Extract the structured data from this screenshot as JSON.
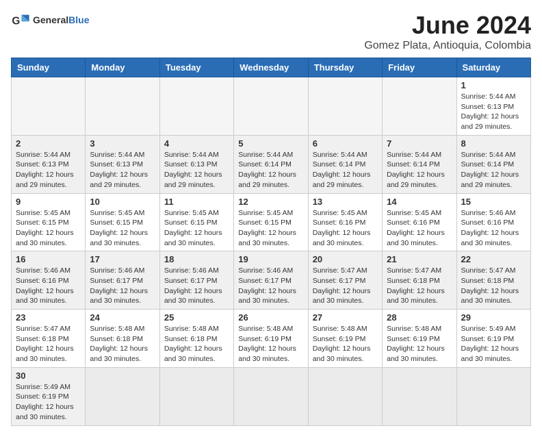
{
  "header": {
    "logo_text_regular": "General",
    "logo_text_blue": "Blue",
    "month_year": "June 2024",
    "location": "Gomez Plata, Antioquia, Colombia"
  },
  "weekdays": [
    "Sunday",
    "Monday",
    "Tuesday",
    "Wednesday",
    "Thursday",
    "Friday",
    "Saturday"
  ],
  "weeks": [
    [
      {
        "day": "",
        "info": ""
      },
      {
        "day": "",
        "info": ""
      },
      {
        "day": "",
        "info": ""
      },
      {
        "day": "",
        "info": ""
      },
      {
        "day": "",
        "info": ""
      },
      {
        "day": "",
        "info": ""
      },
      {
        "day": "1",
        "info": "Sunrise: 5:44 AM\nSunset: 6:13 PM\nDaylight: 12 hours and 29 minutes."
      }
    ],
    [
      {
        "day": "2",
        "info": "Sunrise: 5:44 AM\nSunset: 6:13 PM\nDaylight: 12 hours and 29 minutes."
      },
      {
        "day": "3",
        "info": "Sunrise: 5:44 AM\nSunset: 6:13 PM\nDaylight: 12 hours and 29 minutes."
      },
      {
        "day": "4",
        "info": "Sunrise: 5:44 AM\nSunset: 6:13 PM\nDaylight: 12 hours and 29 minutes."
      },
      {
        "day": "5",
        "info": "Sunrise: 5:44 AM\nSunset: 6:14 PM\nDaylight: 12 hours and 29 minutes."
      },
      {
        "day": "6",
        "info": "Sunrise: 5:44 AM\nSunset: 6:14 PM\nDaylight: 12 hours and 29 minutes."
      },
      {
        "day": "7",
        "info": "Sunrise: 5:44 AM\nSunset: 6:14 PM\nDaylight: 12 hours and 29 minutes."
      },
      {
        "day": "8",
        "info": "Sunrise: 5:44 AM\nSunset: 6:14 PM\nDaylight: 12 hours and 29 minutes."
      }
    ],
    [
      {
        "day": "9",
        "info": "Sunrise: 5:45 AM\nSunset: 6:15 PM\nDaylight: 12 hours and 30 minutes."
      },
      {
        "day": "10",
        "info": "Sunrise: 5:45 AM\nSunset: 6:15 PM\nDaylight: 12 hours and 30 minutes."
      },
      {
        "day": "11",
        "info": "Sunrise: 5:45 AM\nSunset: 6:15 PM\nDaylight: 12 hours and 30 minutes."
      },
      {
        "day": "12",
        "info": "Sunrise: 5:45 AM\nSunset: 6:15 PM\nDaylight: 12 hours and 30 minutes."
      },
      {
        "day": "13",
        "info": "Sunrise: 5:45 AM\nSunset: 6:16 PM\nDaylight: 12 hours and 30 minutes."
      },
      {
        "day": "14",
        "info": "Sunrise: 5:45 AM\nSunset: 6:16 PM\nDaylight: 12 hours and 30 minutes."
      },
      {
        "day": "15",
        "info": "Sunrise: 5:46 AM\nSunset: 6:16 PM\nDaylight: 12 hours and 30 minutes."
      }
    ],
    [
      {
        "day": "16",
        "info": "Sunrise: 5:46 AM\nSunset: 6:16 PM\nDaylight: 12 hours and 30 minutes."
      },
      {
        "day": "17",
        "info": "Sunrise: 5:46 AM\nSunset: 6:17 PM\nDaylight: 12 hours and 30 minutes."
      },
      {
        "day": "18",
        "info": "Sunrise: 5:46 AM\nSunset: 6:17 PM\nDaylight: 12 hours and 30 minutes."
      },
      {
        "day": "19",
        "info": "Sunrise: 5:46 AM\nSunset: 6:17 PM\nDaylight: 12 hours and 30 minutes."
      },
      {
        "day": "20",
        "info": "Sunrise: 5:47 AM\nSunset: 6:17 PM\nDaylight: 12 hours and 30 minutes."
      },
      {
        "day": "21",
        "info": "Sunrise: 5:47 AM\nSunset: 6:18 PM\nDaylight: 12 hours and 30 minutes."
      },
      {
        "day": "22",
        "info": "Sunrise: 5:47 AM\nSunset: 6:18 PM\nDaylight: 12 hours and 30 minutes."
      }
    ],
    [
      {
        "day": "23",
        "info": "Sunrise: 5:47 AM\nSunset: 6:18 PM\nDaylight: 12 hours and 30 minutes."
      },
      {
        "day": "24",
        "info": "Sunrise: 5:48 AM\nSunset: 6:18 PM\nDaylight: 12 hours and 30 minutes."
      },
      {
        "day": "25",
        "info": "Sunrise: 5:48 AM\nSunset: 6:18 PM\nDaylight: 12 hours and 30 minutes."
      },
      {
        "day": "26",
        "info": "Sunrise: 5:48 AM\nSunset: 6:19 PM\nDaylight: 12 hours and 30 minutes."
      },
      {
        "day": "27",
        "info": "Sunrise: 5:48 AM\nSunset: 6:19 PM\nDaylight: 12 hours and 30 minutes."
      },
      {
        "day": "28",
        "info": "Sunrise: 5:48 AM\nSunset: 6:19 PM\nDaylight: 12 hours and 30 minutes."
      },
      {
        "day": "29",
        "info": "Sunrise: 5:49 AM\nSunset: 6:19 PM\nDaylight: 12 hours and 30 minutes."
      }
    ],
    [
      {
        "day": "30",
        "info": "Sunrise: 5:49 AM\nSunset: 6:19 PM\nDaylight: 12 hours and 30 minutes."
      },
      {
        "day": "",
        "info": ""
      },
      {
        "day": "",
        "info": ""
      },
      {
        "day": "",
        "info": ""
      },
      {
        "day": "",
        "info": ""
      },
      {
        "day": "",
        "info": ""
      },
      {
        "day": "",
        "info": ""
      }
    ]
  ]
}
